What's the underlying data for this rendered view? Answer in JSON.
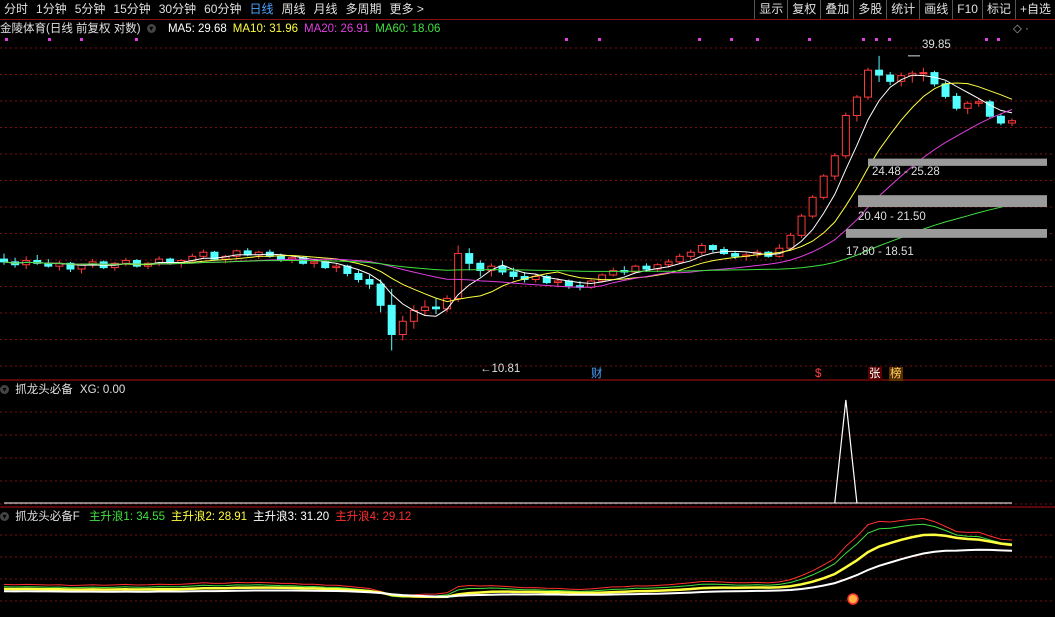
{
  "toolbar": {
    "periods": [
      {
        "label": "分时",
        "active": false
      },
      {
        "label": "1分钟",
        "active": false
      },
      {
        "label": "5分钟",
        "active": false
      },
      {
        "label": "15分钟",
        "active": false
      },
      {
        "label": "30分钟",
        "active": false
      },
      {
        "label": "60分钟",
        "active": false
      },
      {
        "label": "日线",
        "active": true
      },
      {
        "label": "周线",
        "active": false
      },
      {
        "label": "月线",
        "active": false
      },
      {
        "label": "多周期",
        "active": false
      }
    ],
    "more_label": "更多",
    "right_buttons": [
      "显示",
      "复权",
      "叠加",
      "多股",
      "统计",
      "画线",
      "F10",
      "标记",
      "+自选"
    ]
  },
  "main_panel": {
    "title": "金陵体育(日线 前复权 对数)",
    "ma": [
      {
        "label": "MA5: 29.68",
        "color": "#ffffff"
      },
      {
        "label": "MA10: 31.96",
        "color": "#ffff40"
      },
      {
        "label": "MA20: 26.91",
        "color": "#e040e0"
      },
      {
        "label": "MA60: 18.06",
        "color": "#40e040"
      }
    ],
    "high_label": "39.85",
    "low_label": "10.81",
    "gap_labels": [
      "24.48 - 25.28",
      "20.40 - 21.50",
      "17.80 - 18.51"
    ],
    "event_markers": [
      {
        "text": "财",
        "color": "#4aa3ff"
      },
      {
        "text": "$",
        "color": "#ff4040"
      },
      {
        "text": "张",
        "color": "#ffffff"
      },
      {
        "text": "榜",
        "color": "#ffd060"
      }
    ]
  },
  "xg_panel": {
    "title": "抓龙头必备",
    "value_label": "XG: 0.00"
  },
  "wave_panel": {
    "title": "抓龙头必备F",
    "lines": [
      {
        "label": "主升浪1: 34.55",
        "color": "#40e040"
      },
      {
        "label": "主升浪2: 28.91",
        "color": "#ffff40"
      },
      {
        "label": "主升浪3: 31.20",
        "color": "#ffffff"
      },
      {
        "label": "主升浪4: 29.12",
        "color": "#ff3030"
      }
    ]
  },
  "colors": {
    "up": "#ff3b3b",
    "down": "#54ffff",
    "grid": "#7a1010",
    "divider": "#b01010"
  },
  "chart_data": {
    "type": "candlestick",
    "title": "金陵体育(日线 前复权 对数)",
    "scale": "log",
    "ohlc": [
      [
        16.2,
        16.6,
        15.8,
        16.0
      ],
      [
        16.0,
        16.3,
        15.6,
        15.8
      ],
      [
        15.8,
        16.4,
        15.5,
        16.1
      ],
      [
        16.1,
        16.5,
        15.8,
        15.9
      ],
      [
        15.9,
        16.2,
        15.6,
        15.7
      ],
      [
        15.7,
        16.1,
        15.4,
        15.9
      ],
      [
        15.9,
        16.0,
        15.3,
        15.5
      ],
      [
        15.5,
        15.9,
        15.2,
        15.8
      ],
      [
        15.8,
        16.2,
        15.6,
        16.0
      ],
      [
        16.0,
        16.1,
        15.5,
        15.6
      ],
      [
        15.6,
        16.0,
        15.4,
        15.9
      ],
      [
        15.9,
        16.3,
        15.7,
        16.1
      ],
      [
        16.1,
        16.2,
        15.6,
        15.7
      ],
      [
        15.7,
        16.0,
        15.5,
        15.9
      ],
      [
        15.9,
        16.4,
        15.7,
        16.2
      ],
      [
        16.2,
        16.3,
        15.8,
        15.9
      ],
      [
        15.9,
        16.2,
        15.6,
        16.1
      ],
      [
        16.1,
        16.6,
        16.0,
        16.4
      ],
      [
        16.4,
        16.9,
        16.2,
        16.7
      ],
      [
        16.7,
        16.8,
        16.1,
        16.2
      ],
      [
        16.2,
        16.5,
        15.9,
        16.4
      ],
      [
        16.4,
        16.9,
        16.2,
        16.8
      ],
      [
        16.8,
        17.0,
        16.4,
        16.5
      ],
      [
        16.5,
        16.8,
        16.2,
        16.7
      ],
      [
        16.7,
        16.9,
        16.3,
        16.4
      ],
      [
        16.4,
        16.6,
        16.0,
        16.2
      ],
      [
        16.2,
        16.5,
        15.9,
        16.3
      ],
      [
        16.3,
        16.4,
        15.8,
        15.9
      ],
      [
        15.9,
        16.2,
        15.6,
        16.0
      ],
      [
        16.0,
        16.1,
        15.5,
        15.6
      ],
      [
        15.6,
        15.9,
        15.3,
        15.7
      ],
      [
        15.7,
        15.8,
        15.0,
        15.2
      ],
      [
        15.2,
        15.4,
        14.6,
        14.8
      ],
      [
        14.8,
        15.1,
        14.2,
        14.5
      ],
      [
        14.5,
        14.8,
        12.8,
        13.2
      ],
      [
        13.2,
        14.2,
        10.81,
        11.6
      ],
      [
        11.6,
        12.6,
        11.3,
        12.3
      ],
      [
        12.3,
        13.2,
        11.9,
        12.9
      ],
      [
        12.9,
        13.5,
        12.6,
        13.1
      ],
      [
        13.1,
        13.6,
        12.7,
        13.0
      ],
      [
        13.0,
        13.8,
        12.8,
        13.6
      ],
      [
        13.6,
        17.2,
        13.4,
        16.6
      ],
      [
        16.6,
        17.0,
        15.4,
        15.9
      ],
      [
        15.9,
        16.1,
        15.0,
        15.4
      ],
      [
        15.4,
        15.9,
        15.0,
        15.7
      ],
      [
        15.7,
        16.1,
        15.1,
        15.3
      ],
      [
        15.3,
        15.6,
        14.8,
        15.0
      ],
      [
        15.0,
        15.3,
        14.6,
        14.8
      ],
      [
        14.8,
        15.2,
        14.6,
        15.0
      ],
      [
        15.0,
        15.1,
        14.5,
        14.6
      ],
      [
        14.6,
        14.9,
        14.3,
        14.7
      ],
      [
        14.7,
        14.8,
        14.2,
        14.4
      ],
      [
        14.4,
        14.7,
        14.1,
        14.3
      ],
      [
        14.3,
        14.8,
        14.2,
        14.7
      ],
      [
        14.7,
        15.2,
        14.6,
        15.1
      ],
      [
        15.1,
        15.6,
        15.0,
        15.4
      ],
      [
        15.4,
        15.7,
        15.1,
        15.3
      ],
      [
        15.3,
        15.8,
        15.2,
        15.7
      ],
      [
        15.7,
        15.9,
        15.3,
        15.5
      ],
      [
        15.5,
        15.9,
        15.3,
        15.8
      ],
      [
        15.8,
        16.2,
        15.6,
        16.0
      ],
      [
        16.0,
        16.6,
        15.9,
        16.4
      ],
      [
        16.4,
        16.9,
        16.2,
        16.7
      ],
      [
        16.7,
        17.4,
        16.5,
        17.2
      ],
      [
        17.2,
        17.3,
        16.7,
        16.9
      ],
      [
        16.9,
        17.1,
        16.5,
        16.6
      ],
      [
        16.6,
        16.8,
        16.2,
        16.4
      ],
      [
        16.4,
        16.7,
        16.1,
        16.5
      ],
      [
        16.5,
        16.9,
        16.3,
        16.7
      ],
      [
        16.7,
        16.8,
        16.3,
        16.4
      ],
      [
        16.4,
        17.3,
        16.3,
        17.0
      ],
      [
        17.0,
        18.2,
        16.9,
        18.0
      ],
      [
        18.0,
        19.8,
        17.8,
        19.6
      ],
      [
        19.6,
        21.5,
        19.4,
        21.3
      ],
      [
        21.3,
        23.6,
        21.1,
        23.4
      ],
      [
        23.4,
        25.9,
        23.0,
        25.6
      ],
      [
        25.6,
        31.0,
        25.3,
        30.6
      ],
      [
        30.6,
        33.5,
        29.8,
        33.2
      ],
      [
        33.2,
        37.8,
        32.8,
        37.4
      ],
      [
        37.4,
        39.85,
        35.5,
        36.6
      ],
      [
        36.6,
        37.1,
        35.0,
        35.6
      ],
      [
        35.6,
        37.0,
        34.8,
        36.5
      ],
      [
        36.5,
        37.3,
        35.4,
        36.9
      ],
      [
        36.9,
        37.8,
        35.6,
        37.0
      ],
      [
        37.0,
        37.3,
        34.8,
        35.2
      ],
      [
        35.2,
        35.6,
        33.0,
        33.3
      ],
      [
        33.3,
        33.8,
        31.3,
        31.6
      ],
      [
        31.6,
        32.6,
        30.8,
        32.3
      ],
      [
        32.3,
        32.9,
        31.8,
        32.5
      ],
      [
        32.5,
        32.8,
        30.3,
        30.5
      ],
      [
        30.5,
        30.9,
        29.3,
        29.6
      ],
      [
        29.6,
        30.2,
        29.2,
        29.9
      ]
    ],
    "ma_last": {
      "MA5": 29.68,
      "MA10": 31.96,
      "MA20": 26.91,
      "MA60": 18.06
    },
    "high": 39.85,
    "low": 10.81,
    "gaps": [
      [
        24.48,
        25.28
      ],
      [
        20.4,
        21.5
      ],
      [
        17.8,
        18.51
      ]
    ],
    "xg_values_last": 0.0,
    "wave_last": {
      "主升浪1": 34.55,
      "主升浪2": 28.91,
      "主升浪3": 31.2,
      "主升浪4": 29.12
    }
  }
}
